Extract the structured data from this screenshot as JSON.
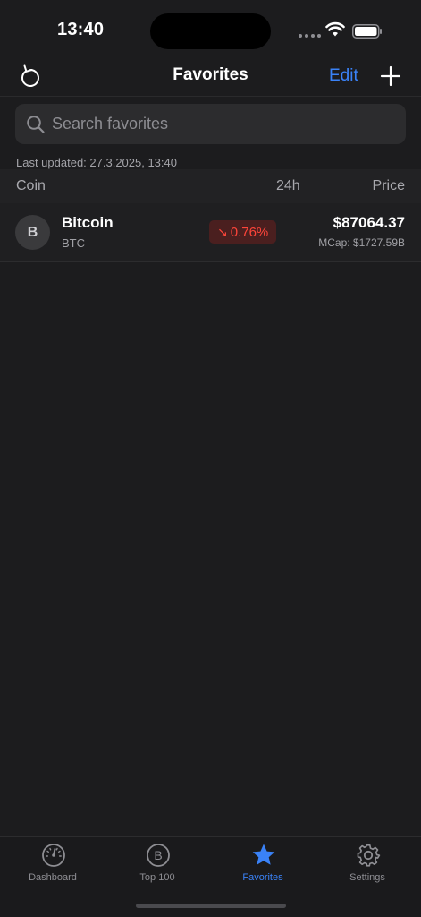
{
  "status_bar": {
    "time": "13:40"
  },
  "nav": {
    "title": "Favorites",
    "edit_label": "Edit"
  },
  "search": {
    "placeholder": "Search favorites",
    "value": ""
  },
  "last_updated": "Last updated: 27.3.2025, 13:40",
  "table": {
    "headers": {
      "coin": "Coin",
      "change": "24h",
      "price": "Price"
    },
    "rows": [
      {
        "avatar_letter": "B",
        "name": "Bitcoin",
        "symbol": "BTC",
        "change": "0.76%",
        "change_direction": "down",
        "price": "$87064.37",
        "mcap": "MCap: $1727.59B"
      }
    ]
  },
  "tabs": [
    {
      "label": "Dashboard",
      "icon": "gauge-icon",
      "active": false
    },
    {
      "label": "Top 100",
      "icon": "bitcoin-icon",
      "active": false
    },
    {
      "label": "Favorites",
      "icon": "star-icon",
      "active": true
    },
    {
      "label": "Settings",
      "icon": "gear-icon",
      "active": false
    }
  ],
  "colors": {
    "accent": "#3a82f7",
    "negative": "#ff453a",
    "background": "#1c1c1e"
  }
}
